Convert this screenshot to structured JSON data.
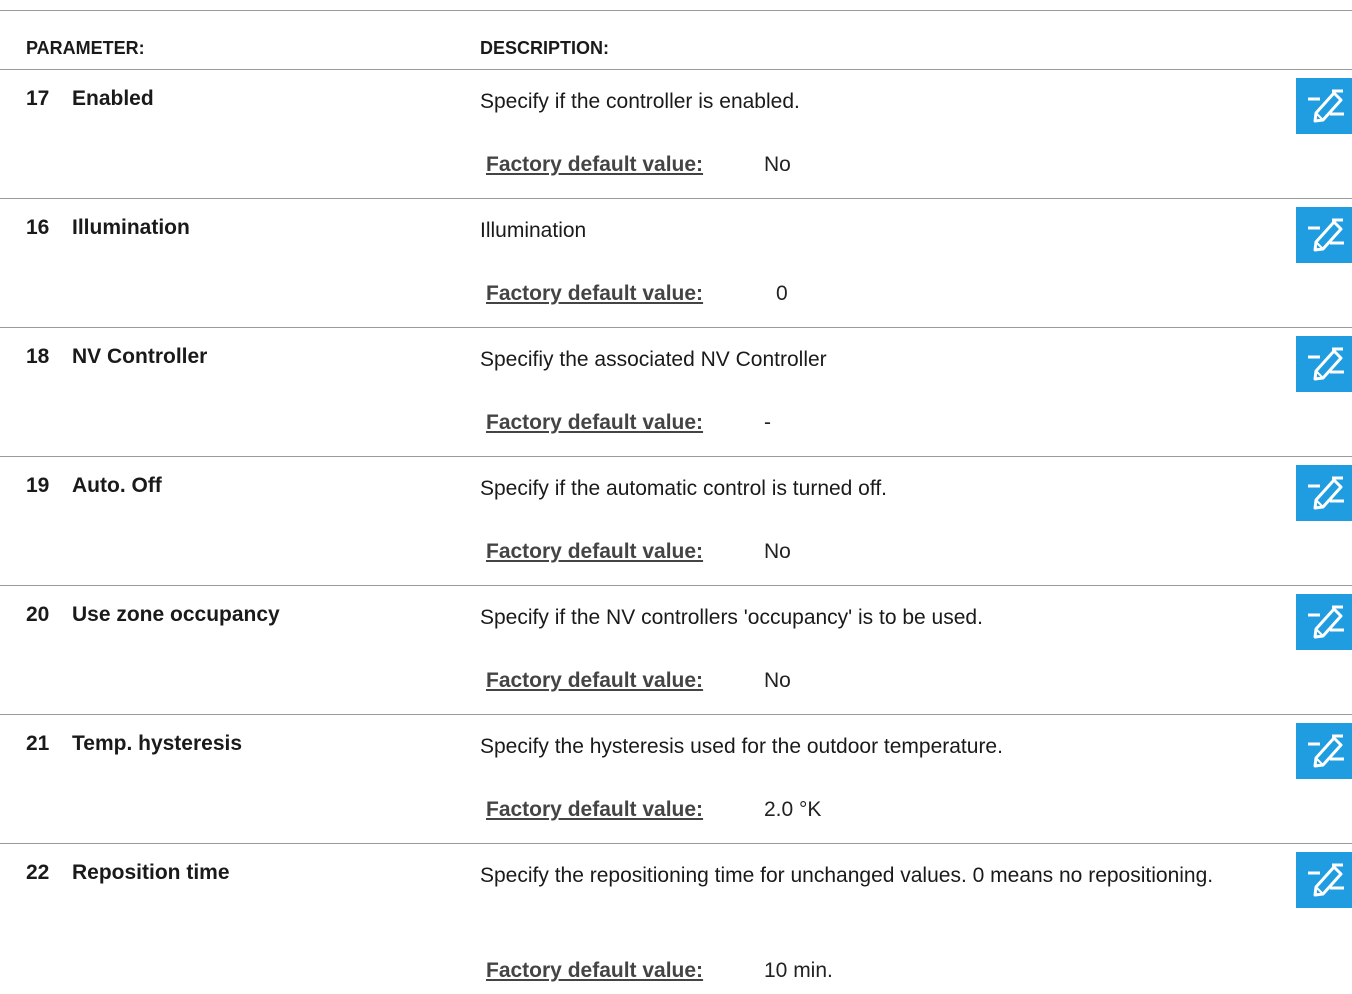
{
  "headers": {
    "parameter": "PARAMETER:",
    "description": "DESCRIPTION:"
  },
  "factory_label": "Factory default value:",
  "edit_icon": "edit-pencil-icon",
  "accent_color": "#1f9de0",
  "rows": [
    {
      "num": "17",
      "name": "Enabled",
      "description": "Specify if the controller is enabled.",
      "default": "No"
    },
    {
      "num": "16",
      "name": "Illumination",
      "description": "Illumination",
      "default": "0"
    },
    {
      "num": "18",
      "name": "NV Controller",
      "description": "Specifiy the associated NV Controller",
      "default": "-"
    },
    {
      "num": "19",
      "name": "Auto. Off",
      "description": "Specify if the automatic control is turned off.",
      "default": "No"
    },
    {
      "num": "20",
      "name": "Use zone occupancy",
      "description": "Specify if the NV controllers 'occupancy' is to be used.",
      "default": "No"
    },
    {
      "num": "21",
      "name": "Temp. hysteresis",
      "description": "Specify the hysteresis used for the outdoor temperature.",
      "default": "2.0 °K"
    },
    {
      "num": "22",
      "name": "Reposition time",
      "description": "Specify the repositioning time for unchanged values. 0 means no repositioning.",
      "default": "10 min."
    }
  ]
}
